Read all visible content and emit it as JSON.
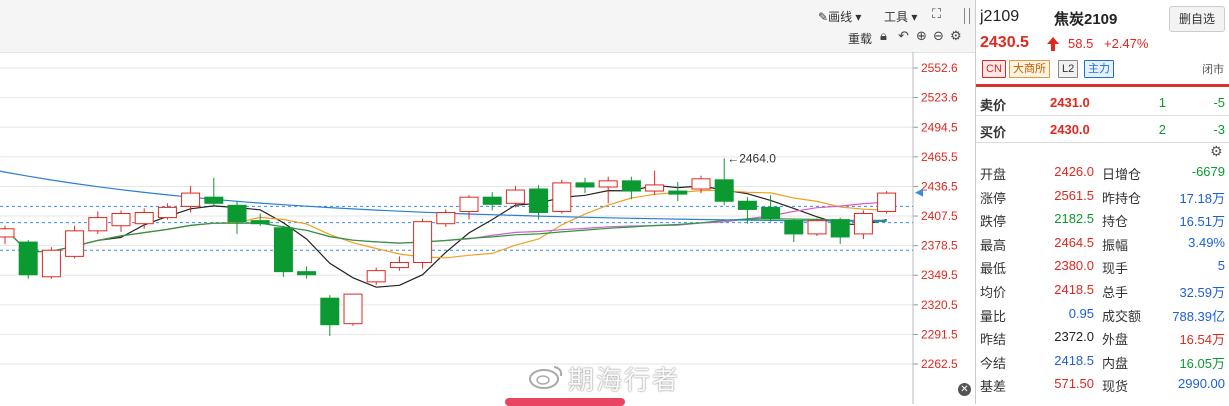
{
  "toolbar": {
    "draw_label": "画线",
    "tools_label": "工具",
    "reload_label": "重载"
  },
  "chart_data": {
    "type": "candlestick",
    "y_ticks": [
      "2552.6",
      "2523.6",
      "2494.5",
      "2465.5",
      "2436.5",
      "2407.5",
      "2378.5",
      "2349.5",
      "2320.5",
      "2291.5",
      "2262.5"
    ],
    "ylim": [
      2262.5,
      2552.6
    ],
    "grid": true,
    "annotation": "←2464.0",
    "annotation_value": 2464.0,
    "candles": [
      {
        "o": 2387,
        "c": 2395,
        "h": 2398,
        "l": 2380
      },
      {
        "o": 2382,
        "c": 2350,
        "h": 2384,
        "l": 2346
      },
      {
        "o": 2348,
        "c": 2374,
        "h": 2377,
        "l": 2346
      },
      {
        "o": 2368,
        "c": 2393,
        "h": 2398,
        "l": 2366
      },
      {
        "o": 2393,
        "c": 2406,
        "h": 2412,
        "l": 2390
      },
      {
        "o": 2398,
        "c": 2410,
        "h": 2413,
        "l": 2392
      },
      {
        "o": 2400,
        "c": 2411,
        "h": 2415,
        "l": 2395
      },
      {
        "o": 2406,
        "c": 2416,
        "h": 2420,
        "l": 2404
      },
      {
        "o": 2417,
        "c": 2430,
        "h": 2437,
        "l": 2411
      },
      {
        "o": 2426,
        "c": 2420,
        "h": 2445,
        "l": 2418
      },
      {
        "o": 2418,
        "c": 2402,
        "h": 2422,
        "l": 2390
      },
      {
        "o": 2403,
        "c": 2400,
        "h": 2410,
        "l": 2398
      },
      {
        "o": 2396,
        "c": 2353,
        "h": 2398,
        "l": 2348
      },
      {
        "o": 2353,
        "c": 2350,
        "h": 2358,
        "l": 2346
      },
      {
        "o": 2327,
        "c": 2301,
        "h": 2330,
        "l": 2290
      },
      {
        "o": 2302,
        "c": 2331,
        "h": 2331,
        "l": 2300
      },
      {
        "o": 2343,
        "c": 2354,
        "h": 2357,
        "l": 2340
      },
      {
        "o": 2357,
        "c": 2362,
        "h": 2368,
        "l": 2354
      },
      {
        "o": 2362,
        "c": 2402,
        "h": 2405,
        "l": 2356
      },
      {
        "o": 2400,
        "c": 2411,
        "h": 2414,
        "l": 2397
      },
      {
        "o": 2412,
        "c": 2426,
        "h": 2428,
        "l": 2404
      },
      {
        "o": 2426,
        "c": 2419,
        "h": 2431,
        "l": 2413
      },
      {
        "o": 2420,
        "c": 2433,
        "h": 2437,
        "l": 2416
      },
      {
        "o": 2434,
        "c": 2411,
        "h": 2438,
        "l": 2404
      },
      {
        "o": 2412,
        "c": 2440,
        "h": 2443,
        "l": 2410
      },
      {
        "o": 2440,
        "c": 2436,
        "h": 2445,
        "l": 2430
      },
      {
        "o": 2436,
        "c": 2442,
        "h": 2446,
        "l": 2420
      },
      {
        "o": 2442,
        "c": 2432,
        "h": 2446,
        "l": 2424
      },
      {
        "o": 2432,
        "c": 2438,
        "h": 2452,
        "l": 2428
      },
      {
        "o": 2432,
        "c": 2429,
        "h": 2441,
        "l": 2422
      },
      {
        "o": 2434,
        "c": 2444,
        "h": 2447,
        "l": 2430
      },
      {
        "o": 2443,
        "c": 2422,
        "h": 2464,
        "l": 2418
      },
      {
        "o": 2422,
        "c": 2414,
        "h": 2426,
        "l": 2400
      },
      {
        "o": 2416,
        "c": 2405,
        "h": 2428,
        "l": 2402
      },
      {
        "o": 2403,
        "c": 2390,
        "h": 2405,
        "l": 2382
      },
      {
        "o": 2390,
        "c": 2403,
        "h": 2405,
        "l": 2388
      },
      {
        "o": 2404,
        "c": 2387,
        "h": 2406,
        "l": 2380
      },
      {
        "o": 2390,
        "c": 2410,
        "h": 2413,
        "l": 2385
      },
      {
        "o": 2412,
        "c": 2430,
        "h": 2432,
        "l": 2410
      }
    ],
    "price_lines": [
      2417,
      2401,
      2374
    ],
    "current_price": 2430.5
  },
  "quote": {
    "code": "j2109",
    "name": "焦炭2109",
    "delete_label": "删自选",
    "price": "2430.5",
    "change": "58.5",
    "change_pct": "+2.47%",
    "tags": [
      "CN",
      "大商所",
      "L2",
      "主力"
    ],
    "status": "闭市",
    "ask_label": "卖价",
    "ask_price": "2431.0",
    "ask_vol": "1",
    "ask_chg": "-5",
    "bid_label": "买价",
    "bid_price": "2430.0",
    "bid_vol": "2",
    "bid_chg": "-3"
  },
  "stats": [
    {
      "l1": "开盘",
      "v1": "2426.0",
      "c1": "red",
      "l2": "日增仓",
      "v2": "-6679",
      "c2": "green"
    },
    {
      "l1": "涨停",
      "v1": "2561.5",
      "c1": "red",
      "l2": "昨持仓",
      "v2": "17.18万",
      "c2": "blue"
    },
    {
      "l1": "跌停",
      "v1": "2182.5",
      "c1": "green",
      "l2": "持仓",
      "v2": "16.51万",
      "c2": "blue"
    },
    {
      "l1": "最高",
      "v1": "2464.5",
      "c1": "red",
      "l2": "振幅",
      "v2": "3.49%",
      "c2": "blue"
    },
    {
      "l1": "最低",
      "v1": "2380.0",
      "c1": "red",
      "l2": "现手",
      "v2": "5",
      "c2": "blue"
    },
    {
      "l1": "均价",
      "v1": "2418.5",
      "c1": "red",
      "l2": "总手",
      "v2": "32.59万",
      "c2": "blue"
    },
    {
      "l1": "量比",
      "v1": "0.95",
      "c1": "blue",
      "l2": "成交额",
      "v2": "788.39亿",
      "c2": "blue"
    },
    {
      "l1": "昨结",
      "v1": "2372.0",
      "c1": "black",
      "l2": "外盘",
      "v2": "16.54万",
      "c2": "red"
    },
    {
      "l1": "今结",
      "v1": "2418.5",
      "c1": "blue",
      "l2": "内盘",
      "v2": "16.05万",
      "c2": "green"
    },
    {
      "l1": "基差",
      "v1": "571.50",
      "c1": "red",
      "l2": "现货",
      "v2": "2990.00",
      "c2": "blue"
    }
  ],
  "watermark": "期海行者",
  "colors": {
    "up": "#e0281f",
    "down": "#0b9a32",
    "grid": "#e6e6e6",
    "axis_text": "#e0281f"
  }
}
